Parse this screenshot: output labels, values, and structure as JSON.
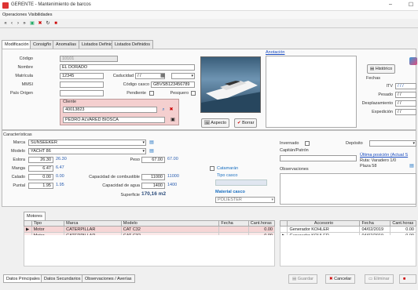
{
  "window": {
    "title": "GERENTE - Mantenimiento de barcos",
    "minimize": "–",
    "close": "☐"
  },
  "menu": {
    "items": [
      "Operaciones",
      "Visibilidades"
    ]
  },
  "tabs": [
    "Modificación",
    "Consigño",
    "Anomalías",
    "Listados Definidos",
    "Listados Definidos"
  ],
  "form": {
    "codigo_label": "Código",
    "codigo_value": "10101",
    "nombre_label": "Nombre",
    "nombre_value": "EL DORADO",
    "matricula_label": "Matrícula",
    "matricula_value": "12345",
    "caducidad_label": "Caducidad",
    "caducidad_value": "/ /",
    "mmsi_label": "MMSI",
    "codigo_casco_label": "Código casco",
    "codigo_casco_value": "GBVSB123456789",
    "pais_label": "País Origen",
    "pendiente_label": "Pendiente",
    "pesquero_label": "Pesquero",
    "cliente_label": "Cliente",
    "cliente_code": "40013823",
    "cliente_name": "PEDRO ALVARED BIOSCA",
    "anotaciones_label": "Anotación",
    "btn_historico": "Histórico",
    "fechas_label": "Fechas",
    "itv_label": "ITV",
    "itv_value": "/ / /",
    "pesado_label": "Pesado",
    "pesado_value": "/ /",
    "desplazado_label": "Desplazamiento",
    "desplazado_value": "/ /",
    "expedicion_label": "Expedición",
    "expedicion_value": "/ /",
    "btn_aspecto": "Aspecto",
    "btn_borrar": "Borrar"
  },
  "specs": {
    "section": "Características",
    "marca_label": "Marca",
    "marca_value": "SUNSEEKER",
    "modelo_label": "Modelo",
    "modelo_value": "YACHT 86",
    "eslora_label": "Eslora",
    "eslora_a": "26.30",
    "eslora_b": "26.30",
    "manga_label": "Manga",
    "manga_a": "6.47",
    "manga_b": "6.47",
    "calado_label": "Calado",
    "calado_a": "0.00",
    "calado_b": "0.00",
    "puntal_label": "Puntal",
    "puntal_a": "1.95",
    "puntal_b": "1.95",
    "peso_label": "Peso",
    "peso_a": "67.00",
    "peso_b": "67.00",
    "combustible_label": "Capacidad de combustible",
    "combustible_a": "11000",
    "combustible_b": "11000",
    "agua_label": "Capacidad de agua",
    "agua_a": "1400",
    "agua_b": "1400",
    "superficie_label": "Superficie",
    "superficie_value": "170,16 m2",
    "catamaran_label": "Catamarán",
    "tipo_casco_label": "Tipo casco",
    "material_label": "Material casco",
    "material_value": "POLIESTER"
  },
  "right_panel": {
    "invernado_label": "Invernado",
    "deposito_label": "Depósito",
    "capitan_label": "Capitán/Patrón",
    "ultima_posicion": "Última posición (Actual S",
    "ruta_label": "Ruta: Varadero 1/0",
    "plaza_label": "Plaza 58",
    "observaciones_label": "Observaciones"
  },
  "motors": {
    "tab": "Motores",
    "headers": [
      "Tipo",
      "Marca",
      "Modelo",
      "Fecha",
      "Cant.horas"
    ],
    "rows": [
      [
        "Motor",
        "CATERPILLAR",
        "CAT C32",
        "",
        "0.00"
      ],
      [
        "Motor",
        "CATERPILLAR",
        "CAT C32",
        "",
        "0.00"
      ]
    ]
  },
  "accessories": {
    "headers": [
      "Accesorio",
      "Fecha",
      "Cant.horas"
    ],
    "rows": [
      [
        "Generador KOHLER",
        "04/02/2019",
        "0.00"
      ],
      [
        "Generador KOHLER",
        "04/02/2019",
        "0.00"
      ]
    ]
  },
  "bottom_tabs": [
    "Datos Principales",
    "Datos Secundarios",
    "Observaciones / Averías"
  ],
  "bottom_buttons": {
    "guardar": "Guardar",
    "cancelar": "Cancelar",
    "eliminar": "Eliminar"
  }
}
